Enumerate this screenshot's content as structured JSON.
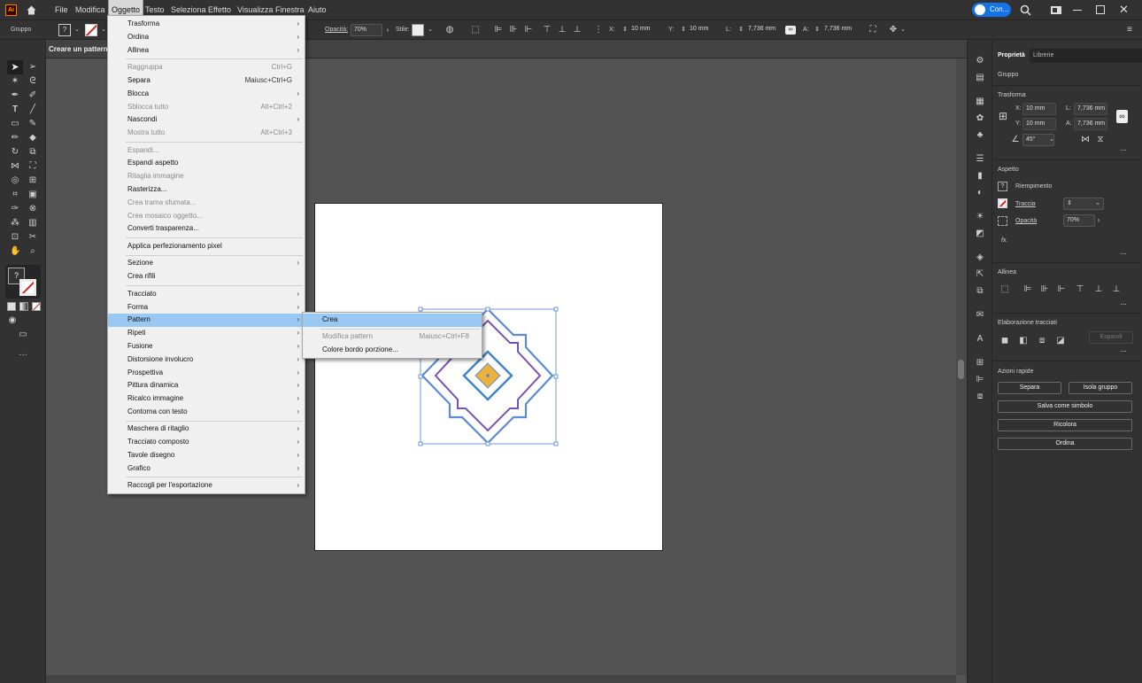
{
  "app": {
    "logo": "Ai",
    "home_icon": "home-icon"
  },
  "menubar": {
    "items": [
      "File",
      "Modifica",
      "Oggetto",
      "Testo",
      "Seleziona",
      "Effetto",
      "Visualizza",
      "Finestra",
      "Aiuto"
    ],
    "active": "Oggetto",
    "account": "Con..."
  },
  "control": {
    "selection": "Gruppo",
    "fill_swatch": "?",
    "opacity_label": "Opacità:",
    "opacity": "70%",
    "style_label": "Stile:",
    "x_label": "X:",
    "x": "10 mm",
    "y_label": "Y:",
    "y": "10 mm",
    "w_label": "L:",
    "w": "7,736 mm",
    "h_label": "A:",
    "h": "7,736 mm"
  },
  "document": {
    "tab": "Creare un pattern-"
  },
  "oggetto_menu": [
    {
      "label": "Trasforma",
      "submenu": true
    },
    {
      "label": "Ordina",
      "submenu": true
    },
    {
      "label": "Allinea",
      "submenu": true
    },
    {
      "sep": true
    },
    {
      "label": "Raggruppa",
      "shortcut": "Ctrl+G",
      "disabled": true
    },
    {
      "label": "Separa",
      "shortcut": "Maiusc+Ctrl+G"
    },
    {
      "label": "Blocca",
      "submenu": true
    },
    {
      "label": "Sblocca tutto",
      "shortcut": "Alt+Ctrl+2",
      "disabled": true
    },
    {
      "label": "Nascondi",
      "submenu": true
    },
    {
      "label": "Mostra tutto",
      "shortcut": "Alt+Ctrl+3",
      "disabled": true
    },
    {
      "sep": true
    },
    {
      "label": "Espandi...",
      "disabled": true
    },
    {
      "label": "Espandi aspetto"
    },
    {
      "label": "Ritaglia immagine",
      "disabled": true
    },
    {
      "label": "Rasterizza..."
    },
    {
      "label": "Crea trama sfumata...",
      "disabled": true
    },
    {
      "label": "Crea mosaico oggetto...",
      "disabled": true
    },
    {
      "label": "Converti trasparenza..."
    },
    {
      "sep": true
    },
    {
      "label": "Applica perfezionamento pixel"
    },
    {
      "sep": true
    },
    {
      "label": "Sezione",
      "submenu": true
    },
    {
      "label": "Crea rifili"
    },
    {
      "sep": true
    },
    {
      "label": "Tracciato",
      "submenu": true
    },
    {
      "label": "Forma",
      "submenu": true
    },
    {
      "label": "Pattern",
      "submenu": true,
      "highlight": true
    },
    {
      "label": "Ripeti",
      "submenu": true
    },
    {
      "label": "Fusione",
      "submenu": true
    },
    {
      "label": "Distorsione involucro",
      "submenu": true
    },
    {
      "label": "Prospettiva",
      "submenu": true
    },
    {
      "label": "Pittura dinamica",
      "submenu": true
    },
    {
      "label": "Ricalco immagine",
      "submenu": true
    },
    {
      "label": "Contorna con testo",
      "submenu": true
    },
    {
      "sep": true
    },
    {
      "label": "Maschera di ritaglio",
      "submenu": true
    },
    {
      "label": "Tracciato composto",
      "submenu": true
    },
    {
      "label": "Tavole disegno",
      "submenu": true
    },
    {
      "label": "Grafico",
      "submenu": true
    },
    {
      "sep": true
    },
    {
      "label": "Raccogli per l'esportazione",
      "submenu": true
    }
  ],
  "pattern_submenu": [
    {
      "label": "Crea",
      "highlight": true
    },
    {
      "sep": true
    },
    {
      "label": "Modifica pattern",
      "shortcut": "Maiusc+Ctrl+F8",
      "disabled": true
    },
    {
      "label": "Colore bordo porzione..."
    }
  ],
  "panel": {
    "tabs": [
      "Proprietà",
      "Librerie"
    ],
    "selection": "Gruppo",
    "transform": {
      "title": "Trasforma",
      "x_label": "X:",
      "x": "10 mm",
      "y_label": "Y:",
      "y": "10 mm",
      "w_label": "L:",
      "w": "7,736 mm",
      "h_label": "A:",
      "h": "7,736 mm",
      "angle": "45°"
    },
    "appearance": {
      "title": "Aspetto",
      "fill": "Riempimento",
      "stroke": "Traccia",
      "opacity": "Opacità",
      "opacity_value": "70%",
      "fx": "fx."
    },
    "align": {
      "title": "Allinea"
    },
    "pathfinder": {
      "title": "Elaborazione tracciati",
      "expand": "Espandi"
    },
    "quick": {
      "title": "Azioni rapide",
      "ungroup": "Separa",
      "isolate": "Isola gruppo",
      "symbol": "Salva come simbolo",
      "recolor": "Ricolora",
      "arrange": "Ordina"
    }
  },
  "colors": {
    "accent": "#1473e6",
    "menu_highlight": "#99c8f2",
    "selection": "#4a7fd4",
    "outer_shape": "#5b8ad6",
    "inner_shape": "#7a52b3",
    "diamond": "#e8b23c"
  }
}
